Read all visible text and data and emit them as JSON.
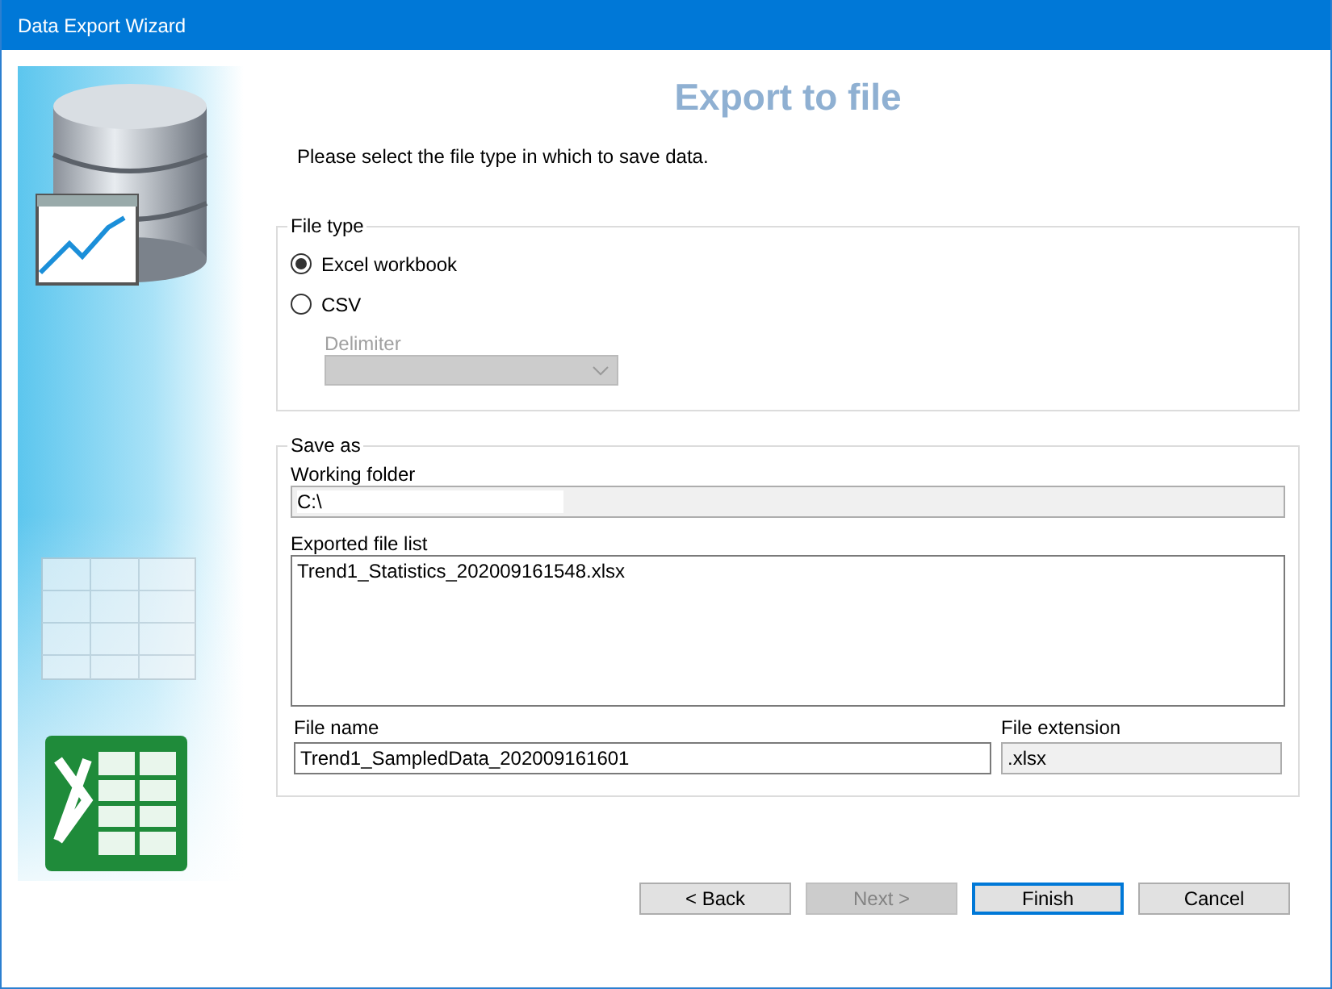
{
  "window": {
    "title": "Data Export Wizard"
  },
  "heading": "Export to file",
  "instruction": "Please select the file type in which to save data.",
  "file_type": {
    "legend": "File type",
    "options": [
      {
        "label": "Excel workbook",
        "selected": true
      },
      {
        "label": "CSV",
        "selected": false
      }
    ],
    "delimiter": {
      "label": "Delimiter",
      "disabled": true
    }
  },
  "save_as": {
    "legend": "Save as",
    "working_folder": {
      "label": "Working folder",
      "value": "C:\\"
    },
    "exported_file_list": {
      "label": "Exported file list",
      "items": [
        "Trend1_Statistics_202009161548.xlsx"
      ]
    },
    "file_name": {
      "label": "File name",
      "value": "Trend1_SampledData_202009161601"
    },
    "file_extension": {
      "label": "File extension",
      "value": ".xlsx"
    }
  },
  "buttons": [
    {
      "label": "< Back",
      "disabled": false,
      "default": false
    },
    {
      "label": "Next >",
      "disabled": true,
      "default": false
    },
    {
      "label": "Finish",
      "disabled": false,
      "default": true
    },
    {
      "label": "Cancel",
      "disabled": false,
      "default": false
    }
  ]
}
